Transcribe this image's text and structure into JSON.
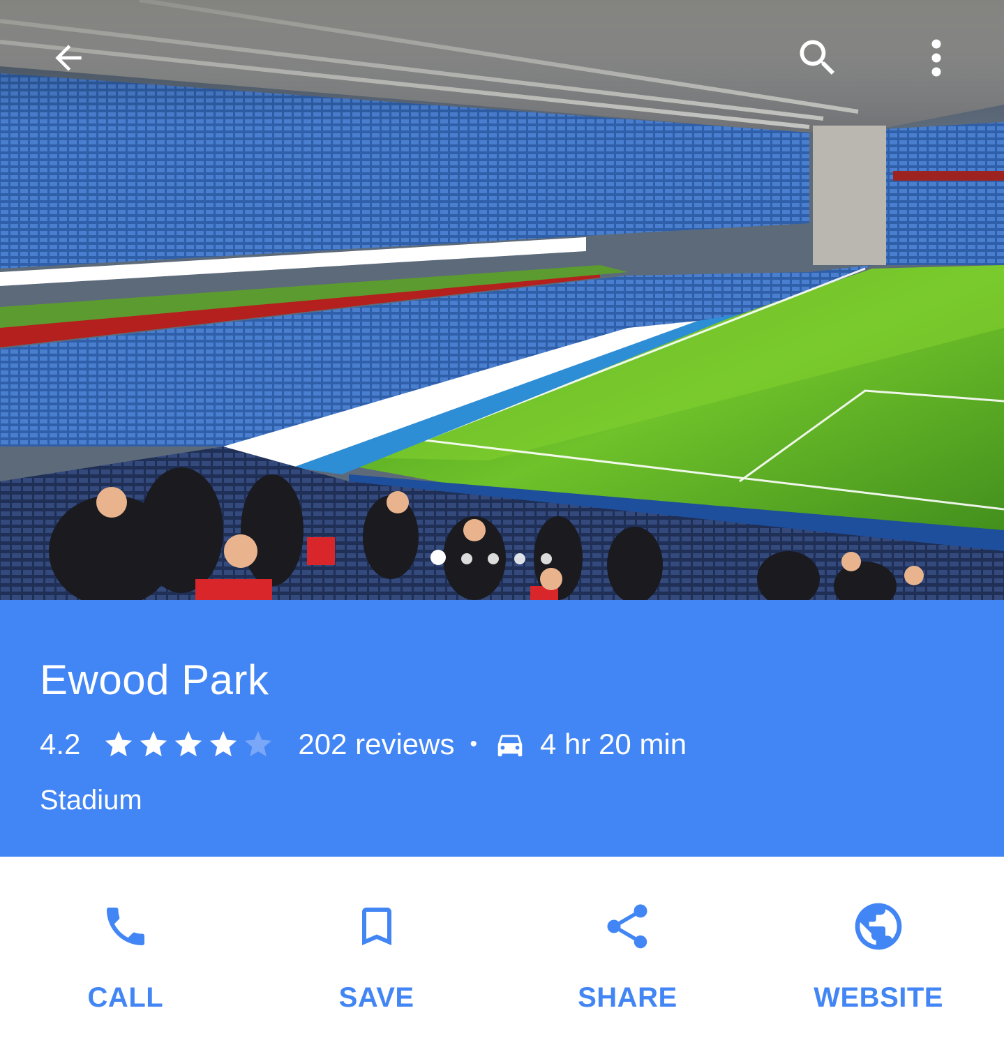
{
  "header": {
    "back_icon": "arrow-back-icon",
    "search_icon": "search-icon",
    "more_icon": "more-vertical-icon",
    "photo_carousel": {
      "total": 5,
      "active_index": 0
    }
  },
  "place": {
    "name": "Ewood Park",
    "rating": "4.2",
    "rating_value": 4.2,
    "max_stars": 5,
    "reviews": "202 reviews",
    "separator": "•",
    "travel_mode_icon": "car-icon",
    "travel_time": "4 hr 20 min",
    "category": "Stadium"
  },
  "actions": [
    {
      "label": "CALL",
      "icon": "phone-icon"
    },
    {
      "label": "SAVE",
      "icon": "bookmark-icon"
    },
    {
      "label": "SHARE",
      "icon": "share-icon"
    },
    {
      "label": "WEBSITE",
      "icon": "globe-icon"
    }
  ],
  "colors": {
    "accent": "#4285f4",
    "on_accent": "#ffffff",
    "star_empty": "#7aa7f7"
  }
}
